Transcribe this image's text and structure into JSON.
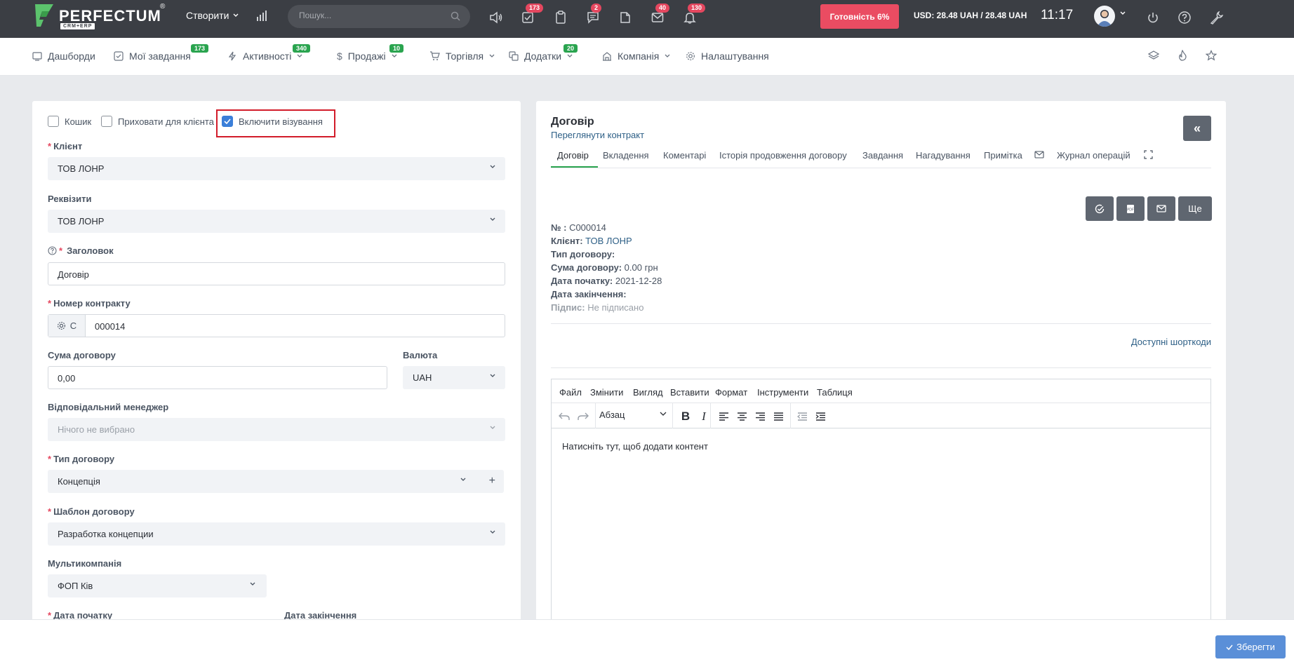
{
  "topbar": {
    "logo_text": "PERFECTUM",
    "logo_sub": "CRM+ERP",
    "logo_reg": "®",
    "create_label": "Створити",
    "search_placeholder": "Пошук...",
    "badges": {
      "tasks": "173",
      "messages": "2",
      "mail": "40",
      "notifications": "130"
    },
    "ready_label": "Готовність 6%",
    "currency_text": "USD: 28.48 UAH / 28.48 UAH",
    "clock": "11:17"
  },
  "nav": {
    "dashboards": "Дашборди",
    "my_tasks": "Мої завдання",
    "my_tasks_badge": "173",
    "activities": "Активності",
    "activities_badge": "340",
    "sales": "Продажі",
    "sales_badge": "10",
    "trade": "Торгівля",
    "addons": "Додатки",
    "addons_badge": "20",
    "company": "Компанія",
    "settings": "Налаштування"
  },
  "form": {
    "trash_label": "Кошик",
    "hide_client_label": "Приховати для клієнта",
    "include_visa_label": "Включити візування",
    "client_label": "Клієнт",
    "client_value": "ТОВ ЛОНР",
    "requisites_label": "Реквізити",
    "requisites_value": "ТОВ ЛОНР",
    "title_label": "Заголовок",
    "title_value": "Договір",
    "contract_no_label": "Номер контракту",
    "contract_prefix": "C",
    "contract_no_value": "000014",
    "amount_label": "Сума договору",
    "amount_value": "0,00",
    "currency_label": "Валюта",
    "currency_value": "UAH",
    "manager_label": "Відповідальний менеджер",
    "manager_placeholder": "Нічого не вибрано",
    "type_label": "Тип договору",
    "type_value": "Концепція",
    "template_label": "Шаблон договору",
    "template_value": "Разработка концепции",
    "multicompany_label": "Мультикомпанія",
    "multicompany_value": "ФОП Ків",
    "start_date_label": "Дата початку",
    "end_date_label": "Дата закінчення"
  },
  "doc": {
    "title": "Договір",
    "view_link": "Переглянути контракт",
    "tabs": [
      "Договір",
      "Вкладення",
      "Коментарі",
      "Історія продовження договору",
      "Завдання",
      "Нагадування",
      "Примітка",
      "Журнал операцій"
    ],
    "more_button": "Ще",
    "meta": {
      "number_label": "№ :",
      "number_value": "C000014",
      "client_label": "Клієнт:",
      "client_value": "ТОВ ЛОНР",
      "type_label": "Тип договору:",
      "amount_label": "Сума договору:",
      "amount_value": "0.00 грн",
      "start_label": "Дата початку:",
      "start_value": "2021-12-28",
      "end_label": "Дата закінчення:",
      "sign_label": "Підпис:",
      "sign_value": "Не підписано"
    },
    "shortcodes_link": "Доступні шорткоди"
  },
  "editor": {
    "menu": [
      "Файл",
      "Змінити",
      "Вигляд",
      "Вставити",
      "Формат",
      "Інструменти",
      "Таблиця"
    ],
    "paragraph": "Абзац",
    "placeholder": "Натисніть тут, щоб додати контент"
  },
  "footer": {
    "save_label": "Зберегти"
  }
}
